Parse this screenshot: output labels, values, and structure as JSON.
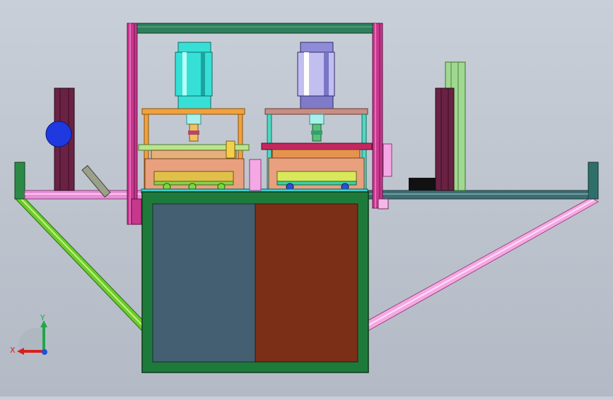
{
  "viewport": {
    "background_top": "#c9cfd8",
    "background_bottom": "#b3bac5"
  },
  "triad": {
    "x_label": "X",
    "y_label": "Y",
    "x_color": "#d91e1e",
    "y_color": "#1fa84a",
    "z_color": "#2450d8"
  },
  "colors": {
    "frame_magenta": "#c8378e",
    "frame_top_bar": "#2f7f5c",
    "cylinder_left": "#37e0d7",
    "cylinder_right": "#8f8bd6",
    "cabinet_frame": "#1e7a3a",
    "cabinet_left_panel": "#445e72",
    "cabinet_right_panel": "#7a2f16",
    "left_leg": "#5cbf2c",
    "right_leg": "#f39ce0",
    "blue_ball": "#1f39e0"
  }
}
